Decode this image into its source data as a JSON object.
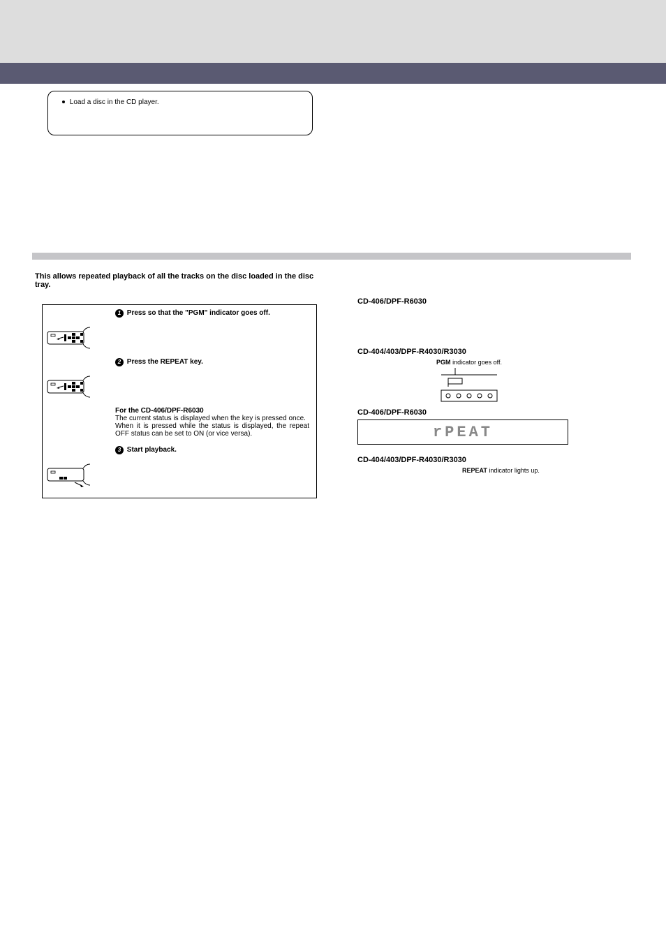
{
  "preparation": {
    "text": "Load a disc in the CD player."
  },
  "intro": "This allows repeated playback of all the tracks on the disc loaded in the disc tray.",
  "steps": {
    "step1": {
      "num": "1",
      "text": "Press so that the \"PGM\" indicator goes off."
    },
    "step2": {
      "num": "2",
      "text": "Press the REPEAT key.",
      "model_heading": "For the CD-406/DPF-R6030",
      "body1": "The current status is displayed when the key is pressed once.",
      "body2": "When it is pressed while the status is displayed, the repeat OFF status can be set to ON (or vice versa)."
    },
    "step3": {
      "num": "3",
      "text": "Start playback."
    }
  },
  "right": {
    "model_a": "CD-406/DPF-R6030",
    "model_b": "CD-404/403/DPF-R4030/R3030",
    "pgm_indicator": "PGM",
    "pgm_indicator_suffix": " indicator goes off.",
    "display_text": "rPEAT",
    "repeat_indicator": "REPEAT",
    "repeat_indicator_suffix": " indicator lights up."
  }
}
